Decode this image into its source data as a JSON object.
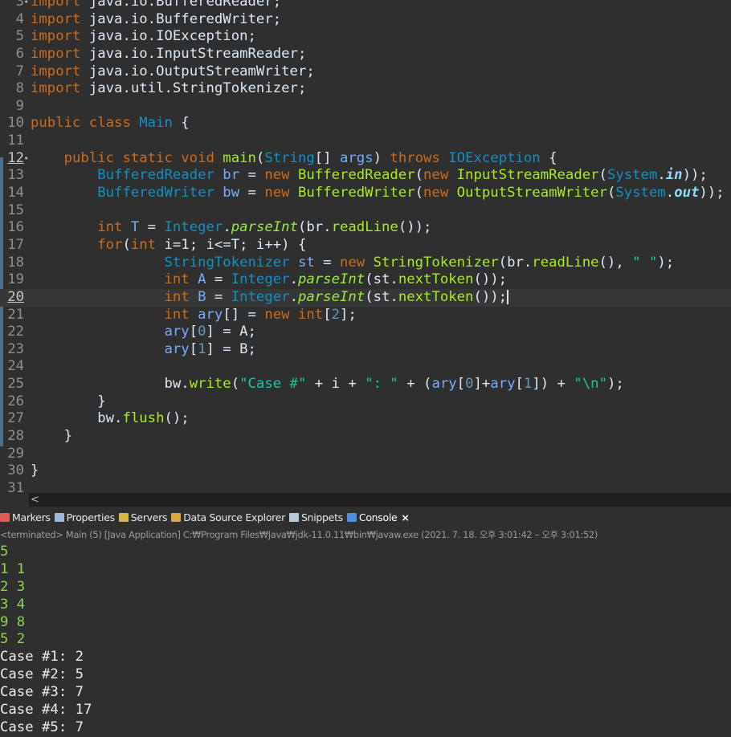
{
  "editor": {
    "lines": [
      {
        "num": "3",
        "fold": true,
        "active": false,
        "current": false,
        "tokens": [
          [
            "import",
            "kw"
          ],
          [
            " java.io.BufferedReader;",
            "plain"
          ]
        ]
      },
      {
        "num": "4",
        "fold": false,
        "active": false,
        "current": false,
        "tokens": [
          [
            "import",
            "kw"
          ],
          [
            " java.io.BufferedWriter;",
            "plain"
          ]
        ]
      },
      {
        "num": "5",
        "fold": false,
        "active": false,
        "current": false,
        "tokens": [
          [
            "import",
            "kw"
          ],
          [
            " java.io.IOException;",
            "plain"
          ]
        ]
      },
      {
        "num": "6",
        "fold": false,
        "active": false,
        "current": false,
        "tokens": [
          [
            "import",
            "kw"
          ],
          [
            " java.io.InputStreamReader;",
            "plain"
          ]
        ]
      },
      {
        "num": "7",
        "fold": false,
        "active": false,
        "current": false,
        "tokens": [
          [
            "import",
            "kw"
          ],
          [
            " java.io.OutputStreamWriter;",
            "plain"
          ]
        ]
      },
      {
        "num": "8",
        "fold": false,
        "active": false,
        "current": false,
        "tokens": [
          [
            "import",
            "kw"
          ],
          [
            " java.util.StringTokenizer;",
            "plain"
          ]
        ]
      },
      {
        "num": "9",
        "fold": false,
        "active": false,
        "current": false,
        "tokens": []
      },
      {
        "num": "10",
        "fold": false,
        "active": false,
        "current": false,
        "tokens": [
          [
            "public class ",
            "kw"
          ],
          [
            "Main",
            "type"
          ],
          [
            " {",
            "plain"
          ]
        ]
      },
      {
        "num": "11",
        "fold": false,
        "active": false,
        "current": false,
        "tokens": []
      },
      {
        "num": "12",
        "fold": true,
        "active": true,
        "current": false,
        "tokens": [
          [
            "    public static void ",
            "kw"
          ],
          [
            "main",
            "method"
          ],
          [
            "(",
            "plain"
          ],
          [
            "String",
            "type"
          ],
          [
            "[] ",
            "plain"
          ],
          [
            "args",
            "var"
          ],
          [
            ") ",
            "plain"
          ],
          [
            "throws ",
            "kw"
          ],
          [
            "IOException",
            "type"
          ],
          [
            " {",
            "plain"
          ]
        ]
      },
      {
        "num": "13",
        "fold": false,
        "active": false,
        "current": false,
        "tokens": [
          [
            "        BufferedReader ",
            "type"
          ],
          [
            "br",
            "var"
          ],
          [
            " = ",
            "plain"
          ],
          [
            "new ",
            "kw"
          ],
          [
            "BufferedReader",
            "method"
          ],
          [
            "(",
            "plain"
          ],
          [
            "new ",
            "kw"
          ],
          [
            "InputStreamReader",
            "method"
          ],
          [
            "(",
            "plain"
          ],
          [
            "System",
            "type"
          ],
          [
            ".",
            "plain"
          ],
          [
            "in",
            "staticbold"
          ],
          [
            "));",
            "plain"
          ]
        ]
      },
      {
        "num": "14",
        "fold": false,
        "active": false,
        "current": false,
        "tokens": [
          [
            "        BufferedWriter ",
            "type"
          ],
          [
            "bw",
            "var"
          ],
          [
            " = ",
            "plain"
          ],
          [
            "new ",
            "kw"
          ],
          [
            "BufferedWriter",
            "method"
          ],
          [
            "(",
            "plain"
          ],
          [
            "new ",
            "kw"
          ],
          [
            "OutputStreamWriter",
            "method"
          ],
          [
            "(",
            "plain"
          ],
          [
            "System",
            "type"
          ],
          [
            ".",
            "plain"
          ],
          [
            "out",
            "staticbold"
          ],
          [
            "));",
            "plain"
          ]
        ]
      },
      {
        "num": "15",
        "fold": false,
        "active": false,
        "current": false,
        "tokens": []
      },
      {
        "num": "16",
        "fold": false,
        "active": false,
        "current": false,
        "tokens": [
          [
            "        int ",
            "kw"
          ],
          [
            "T",
            "var"
          ],
          [
            " = ",
            "plain"
          ],
          [
            "Integer",
            "type"
          ],
          [
            ".",
            "plain"
          ],
          [
            "parseInt",
            "static"
          ],
          [
            "(br.",
            "plain"
          ],
          [
            "readLine",
            "method"
          ],
          [
            "());",
            "plain"
          ]
        ]
      },
      {
        "num": "17",
        "fold": false,
        "active": false,
        "current": false,
        "tokens": [
          [
            "        for",
            "kw"
          ],
          [
            "(",
            "plain"
          ],
          [
            "int ",
            "kw"
          ],
          [
            "i=1; i<=T; i++) {",
            "plain"
          ]
        ]
      },
      {
        "num": "18",
        "fold": false,
        "active": false,
        "current": false,
        "tokens": [
          [
            "                StringTokenizer ",
            "type"
          ],
          [
            "st",
            "var"
          ],
          [
            " = ",
            "plain"
          ],
          [
            "new ",
            "kw"
          ],
          [
            "StringTokenizer",
            "method"
          ],
          [
            "(br.",
            "plain"
          ],
          [
            "readLine",
            "method"
          ],
          [
            "(), ",
            "plain"
          ],
          [
            "\" \"",
            "str"
          ],
          [
            ");",
            "plain"
          ]
        ]
      },
      {
        "num": "19",
        "fold": false,
        "active": false,
        "current": false,
        "tokens": [
          [
            "                int ",
            "kw"
          ],
          [
            "A",
            "var"
          ],
          [
            " = ",
            "plain"
          ],
          [
            "Integer",
            "type"
          ],
          [
            ".",
            "plain"
          ],
          [
            "parseInt",
            "static"
          ],
          [
            "(st.",
            "plain"
          ],
          [
            "nextToken",
            "method"
          ],
          [
            "());",
            "plain"
          ]
        ]
      },
      {
        "num": "20",
        "fold": false,
        "active": true,
        "current": true,
        "tokens": [
          [
            "                int ",
            "kw"
          ],
          [
            "B",
            "var"
          ],
          [
            " = ",
            "plain"
          ],
          [
            "Integer",
            "type"
          ],
          [
            ".",
            "plain"
          ],
          [
            "parseInt",
            "static"
          ],
          [
            "(st.",
            "plain"
          ],
          [
            "nextToken",
            "method"
          ],
          [
            "());",
            "plain"
          ]
        ]
      },
      {
        "num": "21",
        "fold": false,
        "active": false,
        "current": false,
        "tokens": [
          [
            "                int ",
            "kw"
          ],
          [
            "ary",
            "var"
          ],
          [
            "[] = ",
            "plain"
          ],
          [
            "new ",
            "kw"
          ],
          [
            "int",
            "kw"
          ],
          [
            "[",
            "plain"
          ],
          [
            "2",
            "num"
          ],
          [
            "];",
            "plain"
          ]
        ]
      },
      {
        "num": "22",
        "fold": false,
        "active": false,
        "current": false,
        "tokens": [
          [
            "                ary",
            "var"
          ],
          [
            "[",
            "plain"
          ],
          [
            "0",
            "num"
          ],
          [
            "] = A;",
            "plain"
          ]
        ]
      },
      {
        "num": "23",
        "fold": false,
        "active": false,
        "current": false,
        "tokens": [
          [
            "                ary",
            "var"
          ],
          [
            "[",
            "plain"
          ],
          [
            "1",
            "num"
          ],
          [
            "] = B;",
            "plain"
          ]
        ]
      },
      {
        "num": "24",
        "fold": false,
        "active": false,
        "current": false,
        "tokens": []
      },
      {
        "num": "25",
        "fold": false,
        "active": false,
        "current": false,
        "tokens": [
          [
            "                bw.",
            "plain"
          ],
          [
            "write",
            "method"
          ],
          [
            "(",
            "plain"
          ],
          [
            "\"Case #\"",
            "str"
          ],
          [
            " + i + ",
            "plain"
          ],
          [
            "\": \"",
            "str"
          ],
          [
            " + (",
            "plain"
          ],
          [
            "ary",
            "var"
          ],
          [
            "[",
            "plain"
          ],
          [
            "0",
            "num"
          ],
          [
            "]+",
            "plain"
          ],
          [
            "ary",
            "var"
          ],
          [
            "[",
            "plain"
          ],
          [
            "1",
            "num"
          ],
          [
            "]) + ",
            "plain"
          ],
          [
            "\"\\n\"",
            "str"
          ],
          [
            ");",
            "plain"
          ]
        ]
      },
      {
        "num": "26",
        "fold": false,
        "active": false,
        "current": false,
        "tokens": [
          [
            "        }",
            "plain"
          ]
        ]
      },
      {
        "num": "27",
        "fold": false,
        "active": false,
        "current": false,
        "tokens": [
          [
            "        bw.",
            "plain"
          ],
          [
            "flush",
            "method"
          ],
          [
            "();",
            "plain"
          ]
        ]
      },
      {
        "num": "28",
        "fold": false,
        "active": false,
        "current": false,
        "tokens": [
          [
            "    }",
            "plain"
          ]
        ]
      },
      {
        "num": "29",
        "fold": false,
        "active": false,
        "current": false,
        "tokens": []
      },
      {
        "num": "30",
        "fold": false,
        "active": false,
        "current": false,
        "tokens": [
          [
            "}",
            "plain"
          ]
        ]
      },
      {
        "num": "31",
        "fold": false,
        "active": false,
        "current": false,
        "tokens": []
      }
    ],
    "scroll_left_label": "<"
  },
  "console": {
    "tabs": [
      {
        "label": "Markers",
        "icon": "markers-icon",
        "color": "#e05a5a",
        "active": false
      },
      {
        "label": "Properties",
        "icon": "properties-icon",
        "color": "#9fb9d9",
        "active": false
      },
      {
        "label": "Servers",
        "icon": "servers-icon",
        "color": "#d9b64a",
        "active": false
      },
      {
        "label": "Data Source Explorer",
        "icon": "data-source-icon",
        "color": "#d9a640",
        "active": false
      },
      {
        "label": "Snippets",
        "icon": "snippets-icon",
        "color": "#b9c9d9",
        "active": false
      },
      {
        "label": "Console",
        "icon": "console-icon",
        "color": "#4f8fd9",
        "active": true
      }
    ],
    "close_label": "×",
    "status": "<terminated> Main (5) [Java Application] C:₩Program Files₩Java₩jdk-11.0.11₩bin₩javaw.exe  (2021. 7. 18. 오후 3:01:42 – 오후 3:01:52)",
    "output": [
      {
        "text": "5",
        "input": true
      },
      {
        "text": "1 1",
        "input": true
      },
      {
        "text": "2 3",
        "input": true
      },
      {
        "text": "3 4",
        "input": true
      },
      {
        "text": "9 8",
        "input": true
      },
      {
        "text": "5 2",
        "input": true
      },
      {
        "text": "Case #1: 2",
        "input": false
      },
      {
        "text": "Case #2: 5",
        "input": false
      },
      {
        "text": "Case #3: 7",
        "input": false
      },
      {
        "text": "Case #4: 17",
        "input": false
      },
      {
        "text": "Case #5: 7",
        "input": false
      }
    ]
  }
}
